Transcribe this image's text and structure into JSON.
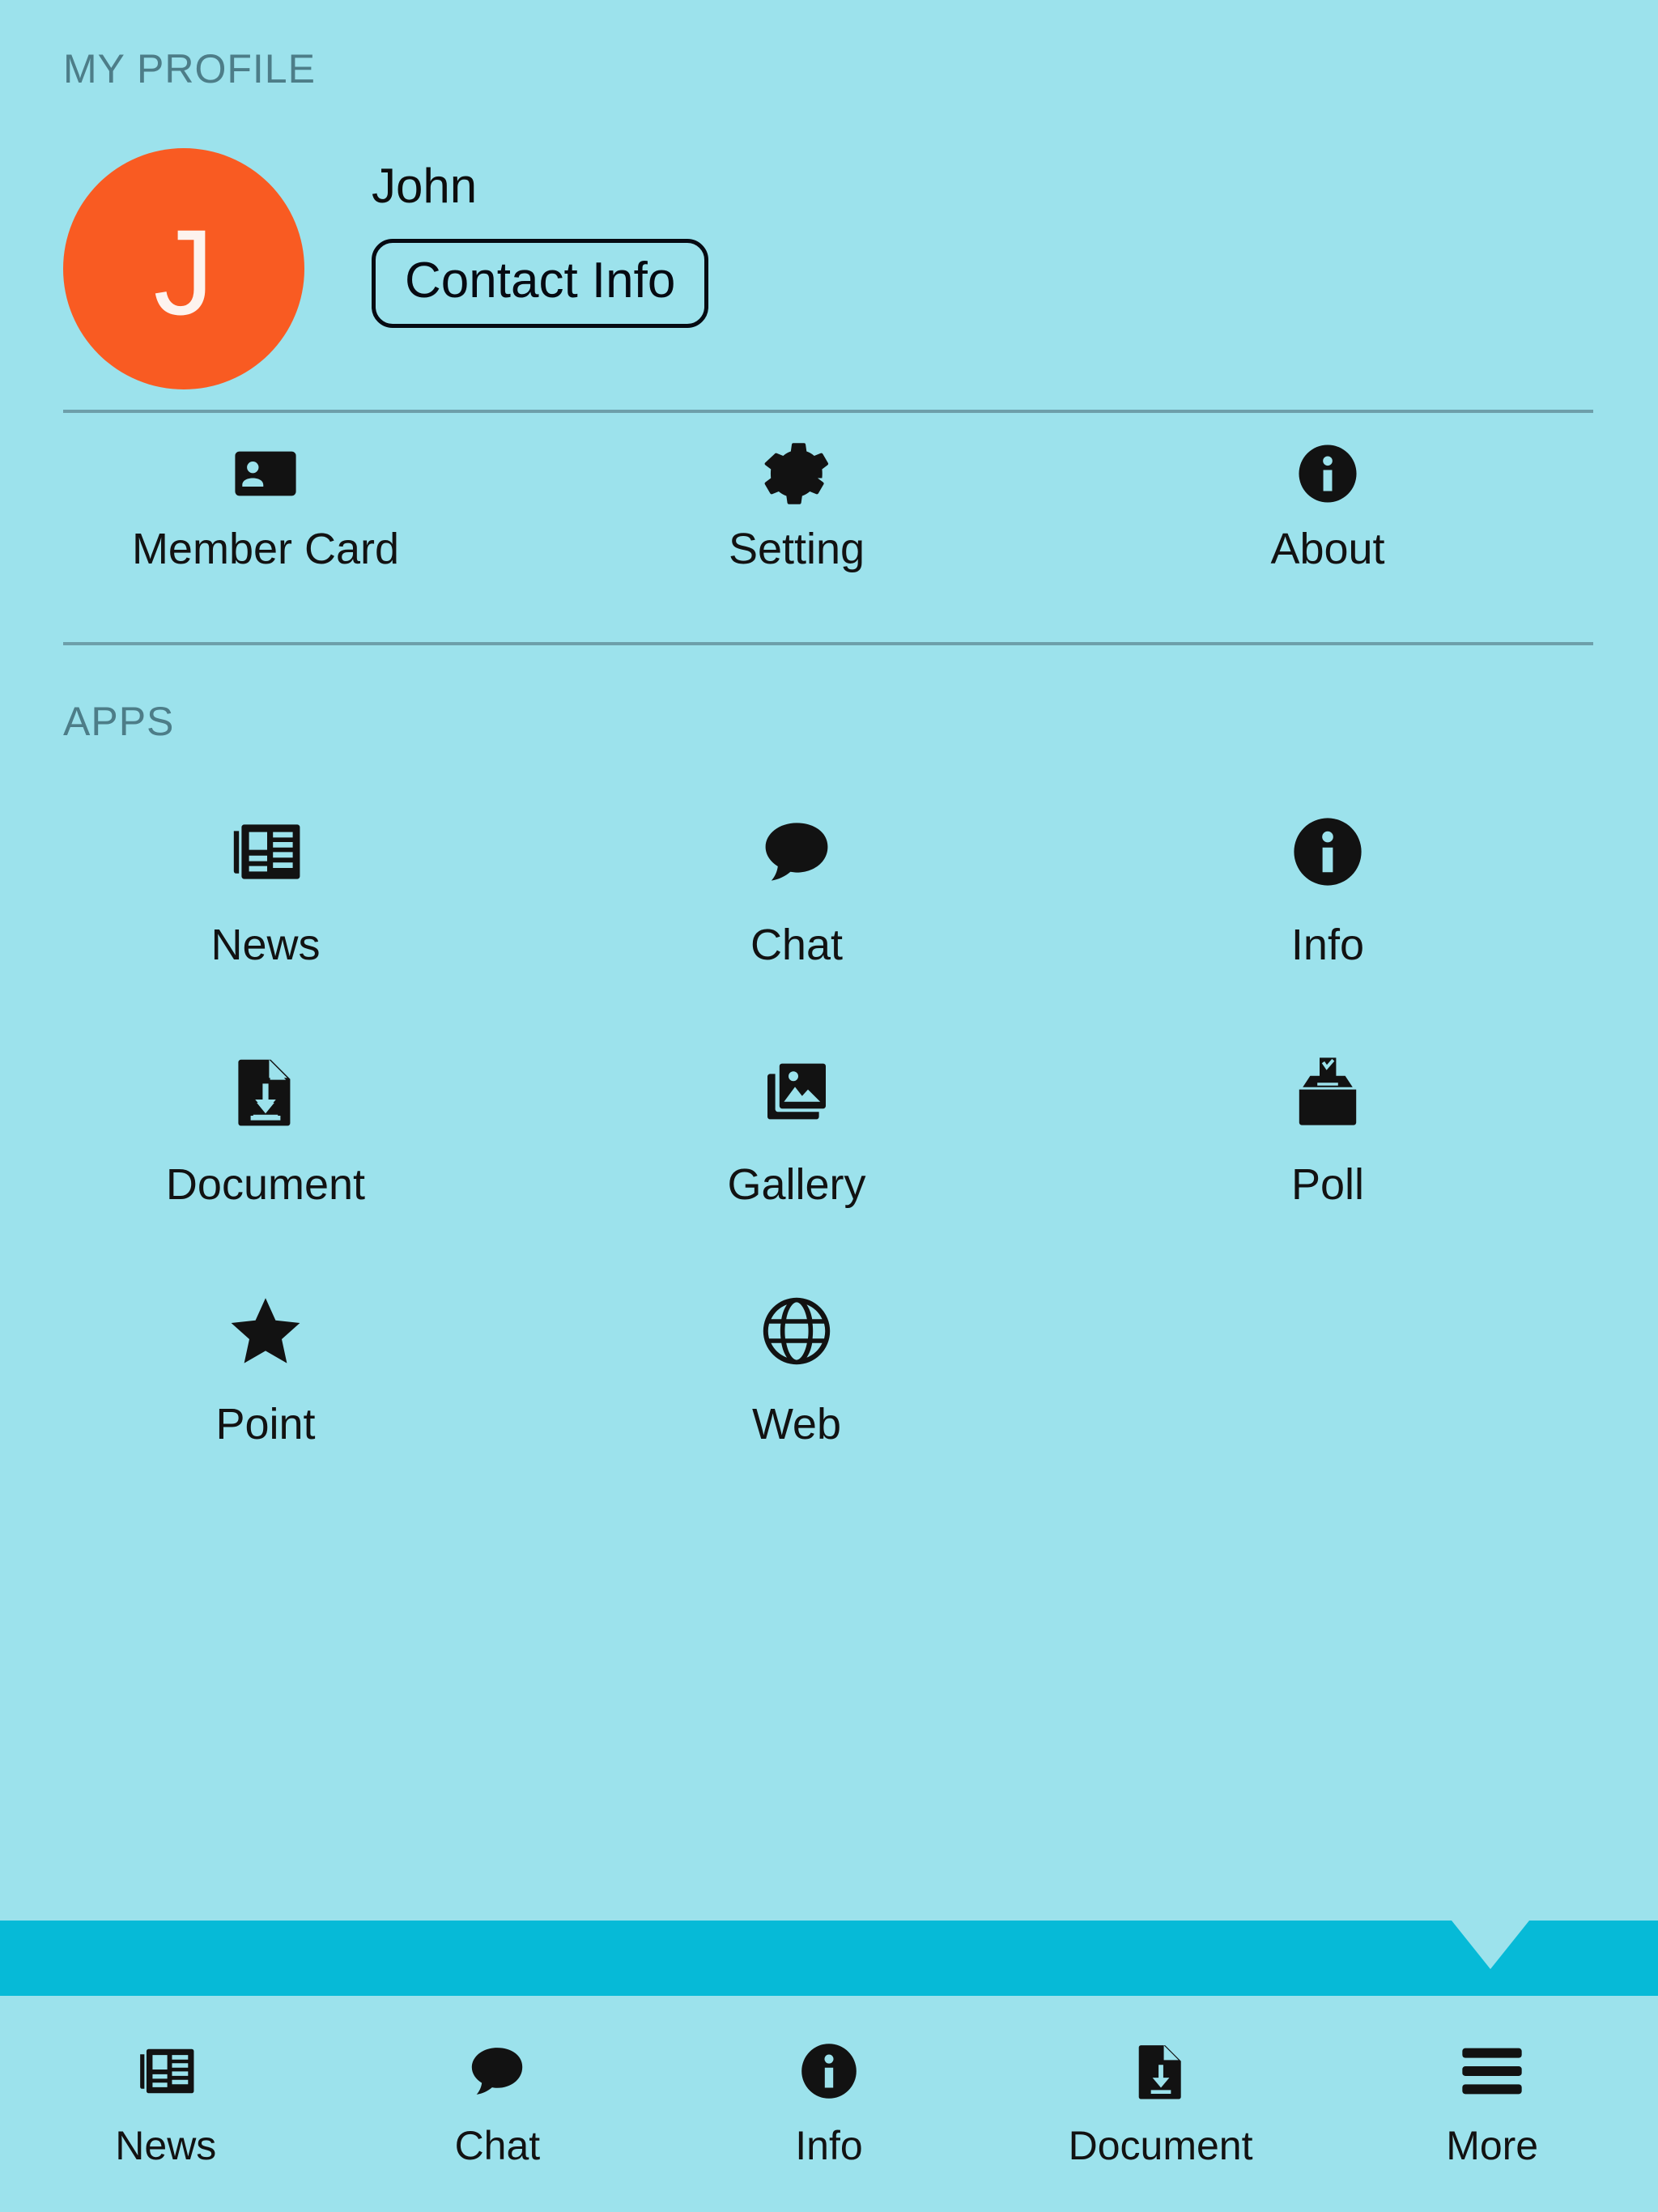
{
  "profile_section": {
    "header": "MY PROFILE",
    "avatar_initial": "J",
    "avatar_color": "#f95b22",
    "name": "John",
    "contact_button": "Contact Info"
  },
  "quick_actions": [
    {
      "label": "Member Card",
      "icon": "id-card-icon"
    },
    {
      "label": "Setting",
      "icon": "gear-icon"
    },
    {
      "label": "About",
      "icon": "info-circle-icon"
    }
  ],
  "apps_section": {
    "header": "APPS",
    "items": [
      {
        "label": "News",
        "icon": "newspaper-icon"
      },
      {
        "label": "Chat",
        "icon": "speech-bubble-icon"
      },
      {
        "label": "Info",
        "icon": "info-circle-icon"
      },
      {
        "label": "Document",
        "icon": "file-download-icon"
      },
      {
        "label": "Gallery",
        "icon": "photo-stack-icon"
      },
      {
        "label": "Poll",
        "icon": "ballot-box-icon"
      },
      {
        "label": "Point",
        "icon": "star-icon"
      },
      {
        "label": "Web",
        "icon": "globe-icon"
      }
    ]
  },
  "bottom_nav": {
    "items": [
      {
        "label": "News",
        "icon": "newspaper-icon"
      },
      {
        "label": "Chat",
        "icon": "speech-bubble-icon"
      },
      {
        "label": "Info",
        "icon": "info-circle-icon"
      },
      {
        "label": "Document",
        "icon": "file-download-icon"
      },
      {
        "label": "More",
        "icon": "hamburger-menu-icon"
      }
    ]
  },
  "colors": {
    "background": "#9ce2ec",
    "accent_strip": "#06bad7",
    "avatar": "#f95b22",
    "divider": "#6d9faa",
    "section_label": "#4d7d88",
    "icon": "#121212"
  }
}
